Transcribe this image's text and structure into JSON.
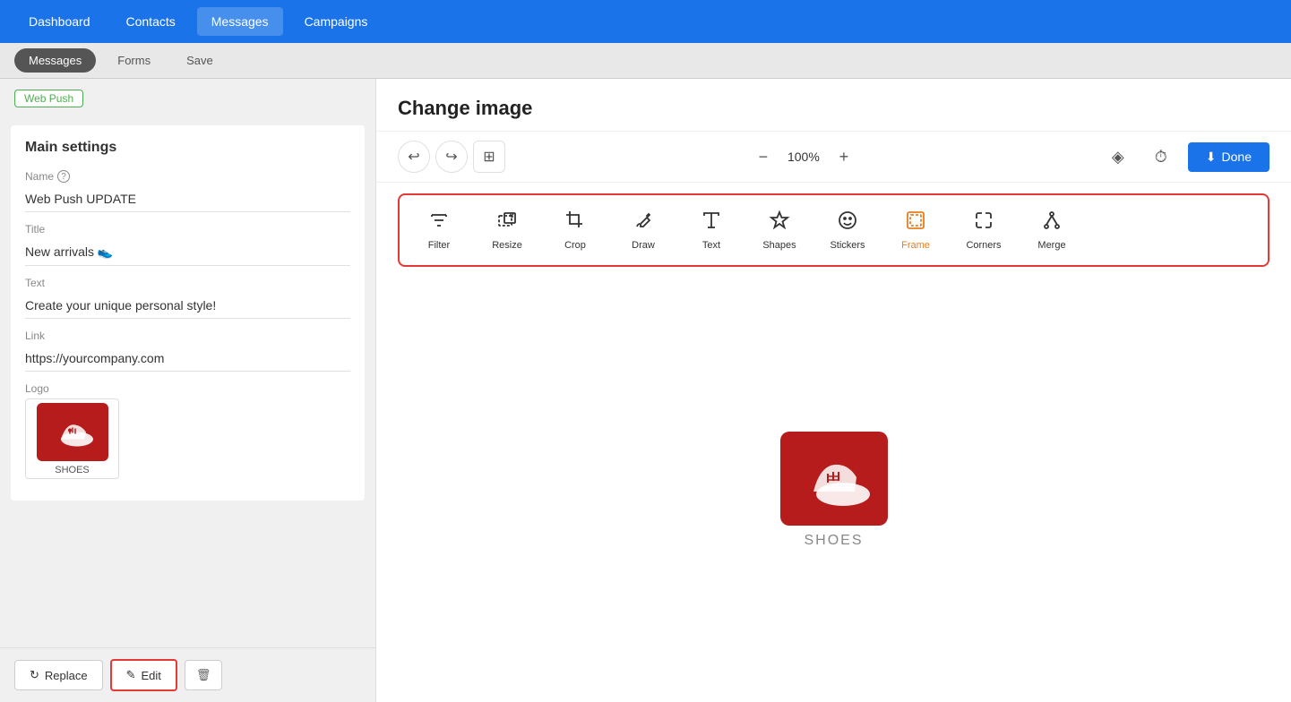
{
  "topNav": {
    "items": [
      {
        "label": "Dashboard",
        "active": false
      },
      {
        "label": "Contacts",
        "active": false
      },
      {
        "label": "Messages",
        "active": true
      },
      {
        "label": "Campaigns",
        "active": false
      }
    ]
  },
  "subNav": {
    "items": [
      {
        "label": "Messages",
        "active": true
      },
      {
        "label": "Forms",
        "active": false
      },
      {
        "label": "Save",
        "active": false
      }
    ]
  },
  "sidebar": {
    "badge": "Web Push",
    "mainSettings": {
      "title": "Main settings",
      "name": {
        "label": "Name",
        "value": "Web Push UPDATE"
      },
      "title_field": {
        "label": "Title",
        "value": "New arrivals 👟"
      },
      "text": {
        "label": "Text",
        "value": "Create your unique personal style!"
      },
      "link": {
        "label": "Link",
        "value": "https://yourcompany.com"
      },
      "logo": {
        "label": "Logo",
        "thumbnail_text": "SHOES"
      }
    }
  },
  "bottomActions": {
    "replace": "Replace",
    "edit": "Edit",
    "delete_icon": "🗑"
  },
  "changeImage": {
    "title": "Change image",
    "zoom": "100%",
    "doneLabel": "Done",
    "tools": [
      {
        "id": "filter",
        "label": "Filter",
        "icon": "⊟",
        "orange": false
      },
      {
        "id": "resize",
        "label": "Resize",
        "icon": "⊠",
        "orange": false
      },
      {
        "id": "crop",
        "label": "Crop",
        "icon": "⊡",
        "orange": false
      },
      {
        "id": "draw",
        "label": "Draw",
        "icon": "✏",
        "orange": false
      },
      {
        "id": "text",
        "label": "Text",
        "icon": "T",
        "orange": false
      },
      {
        "id": "shapes",
        "label": "Shapes",
        "icon": "★",
        "orange": false
      },
      {
        "id": "stickers",
        "label": "Stickers",
        "icon": "☺",
        "orange": false
      },
      {
        "id": "frame",
        "label": "Frame",
        "orange": true
      },
      {
        "id": "corners",
        "label": "Corners",
        "orange": false
      },
      {
        "id": "merge",
        "label": "Merge",
        "orange": false
      }
    ],
    "imageLabel": "SHOES"
  }
}
